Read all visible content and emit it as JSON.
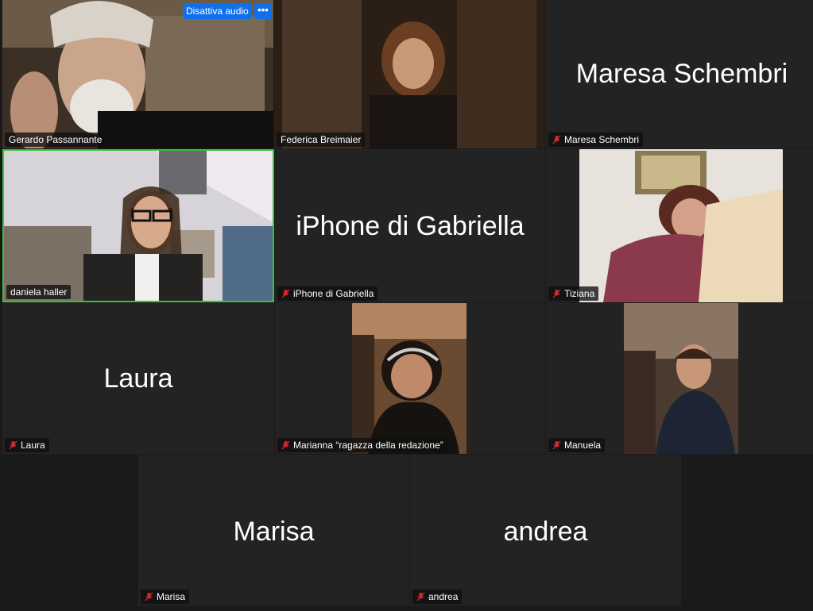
{
  "controls": {
    "mute_audio_label": "Disattiva audio",
    "more_label": "•••"
  },
  "participants": [
    {
      "name": "Gerardo Passannante",
      "video": true,
      "muted": false
    },
    {
      "name": "Federica Breimaier",
      "video": true,
      "muted": false
    },
    {
      "name": "Maresa Schembri",
      "video": false,
      "muted": true,
      "display_name": "Maresa Schembri"
    },
    {
      "name": "daniela haller",
      "video": true,
      "muted": false,
      "active_speaker": true
    },
    {
      "name": "iPhone di Gabriella",
      "video": false,
      "muted": true,
      "display_name": "iPhone di Gabriella"
    },
    {
      "name": "Tiziana",
      "video": true,
      "muted": true
    },
    {
      "name": "Laura",
      "video": false,
      "muted": true,
      "display_name": "Laura"
    },
    {
      "name": "Marianna “ragazza della redazione”",
      "video": true,
      "muted": true
    },
    {
      "name": "Manuela",
      "video": true,
      "muted": true
    },
    {
      "name": "Marisa",
      "video": false,
      "muted": true,
      "display_name": "Marisa"
    },
    {
      "name": "andrea",
      "video": false,
      "muted": true,
      "display_name": "andrea"
    }
  ],
  "colors": {
    "tile_bg": "#232323",
    "active_speaker_border": "#3cc13b",
    "button_blue": "#0e71eb",
    "muted_red": "#e02828"
  }
}
